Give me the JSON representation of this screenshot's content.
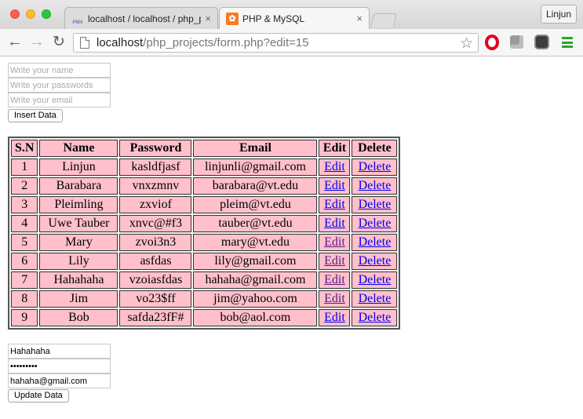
{
  "browser": {
    "tabs": [
      {
        "title": "localhost / localhost / php_p",
        "icon": "phpmyadmin-icon",
        "active": false
      },
      {
        "title": "PHP & MySQL",
        "icon": "xampp-icon",
        "active": true
      }
    ],
    "tab_close_glyph": "×",
    "profile_name": "Linjun",
    "url_host": "localhost",
    "url_path": "/php_projects/form.php?edit=15",
    "icons": {
      "back": "←",
      "forward": "→",
      "reload": "↻",
      "bookmark": "☆",
      "pma_favicon": "PMA",
      "xampp_favicon": "✿"
    }
  },
  "insert_form": {
    "name_placeholder": "Write your name",
    "password_placeholder": "Write your passwords",
    "email_placeholder": "Write your email",
    "submit_label": "Insert Data"
  },
  "table": {
    "headers": {
      "sn": "S.N",
      "name": "Name",
      "password": "Password",
      "email": "Email",
      "edit": "Edit",
      "delete": "Delete"
    },
    "rows": [
      {
        "sn": "1",
        "name": "Linjun",
        "password": "kasldfjasf",
        "email": "linjunli@gmail.com",
        "edit": "Edit",
        "delete": "Delete",
        "edit_visited": false
      },
      {
        "sn": "2",
        "name": "Barabara",
        "password": "vnxzmnv",
        "email": "barabara@vt.edu",
        "edit": "Edit",
        "delete": "Delete",
        "edit_visited": false
      },
      {
        "sn": "3",
        "name": "Pleimling",
        "password": "zxviof",
        "email": "pleim@vt.edu",
        "edit": "Edit",
        "delete": "Delete",
        "edit_visited": false
      },
      {
        "sn": "4",
        "name": "Uwe Tauber",
        "password": "xnvc@#f3",
        "email": "tauber@vt.edu",
        "edit": "Edit",
        "delete": "Delete",
        "edit_visited": false
      },
      {
        "sn": "5",
        "name": "Mary",
        "password": "zvoi3n3",
        "email": "mary@vt.edu",
        "edit": "Edit",
        "delete": "Delete",
        "edit_visited": true
      },
      {
        "sn": "6",
        "name": "Lily",
        "password": "asfdas",
        "email": "lily@gmail.com",
        "edit": "Edit",
        "delete": "Delete",
        "edit_visited": true
      },
      {
        "sn": "7",
        "name": "Hahahaha",
        "password": "vzoiasfdas",
        "email": "hahaha@gmail.com",
        "edit": "Edit",
        "delete": "Delete",
        "edit_visited": true
      },
      {
        "sn": "8",
        "name": "Jim",
        "password": "vo23$ff",
        "email": "jim@yahoo.com",
        "edit": "Edit",
        "delete": "Delete",
        "edit_visited": true
      },
      {
        "sn": "9",
        "name": "Bob",
        "password": "safda23fF#",
        "email": "bob@aol.com",
        "edit": "Edit",
        "delete": "Delete",
        "edit_visited": false
      }
    ],
    "colors": {
      "cell_bg": "#ffc0cb",
      "link": "#0000ee",
      "visited_link": "#551a8b"
    }
  },
  "update_form": {
    "name_value": "Hahahaha",
    "password_value": "vzoiasfda",
    "email_value": "hahaha@gmail.com",
    "submit_label": "Update Data"
  }
}
